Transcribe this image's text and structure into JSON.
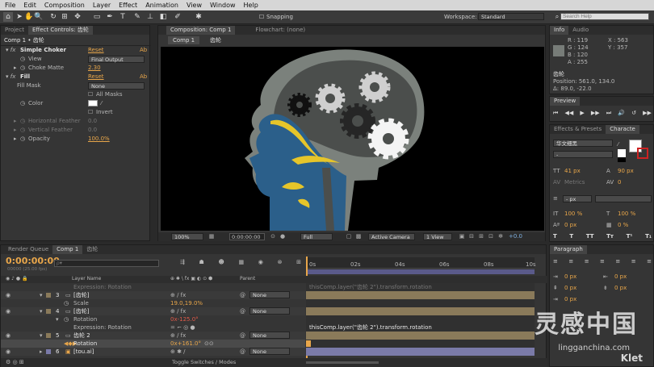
{
  "menu": [
    "File",
    "Edit",
    "Composition",
    "Layer",
    "Effect",
    "Animation",
    "View",
    "Window",
    "Help"
  ],
  "toolbar": {
    "snapping": "Snapping",
    "workspace_label": "Workspace:",
    "workspace_value": "Standard",
    "search_placeholder": "Search Help"
  },
  "effect_controls": {
    "tabs": [
      "Project",
      "Effect Controls: 齿轮"
    ],
    "breadcrumb": "Comp 1 • 齿轮",
    "effects": [
      {
        "name": "Simple Choker",
        "reset": "Reset",
        "ab": "Ab",
        "props": [
          {
            "label": "View",
            "value": "Final Output"
          },
          {
            "label": "Choke Matte",
            "value": "2.30"
          }
        ]
      },
      {
        "name": "Fill",
        "reset": "Reset",
        "ab": "Ab",
        "props": [
          {
            "label": "Fill Mask",
            "value": "None"
          },
          {
            "label": "",
            "value": "All Masks"
          },
          {
            "label": "Color",
            "value": ""
          },
          {
            "label": "",
            "value": "Invert"
          },
          {
            "label": "Horizontal Feather",
            "value": "0.0"
          },
          {
            "label": "Vertical Feather",
            "value": "0.0"
          },
          {
            "label": "Opacity",
            "value": "100.0%"
          }
        ]
      }
    ]
  },
  "composition": {
    "tabs": [
      "Composition: Comp 1",
      "Flowchart: (none)"
    ],
    "subtabs": [
      "Comp 1",
      "齿轮"
    ],
    "footer": {
      "zoom": "100%",
      "timecode": "0:00:00:00",
      "resolution": "Full",
      "camera": "Active Camera",
      "view": "1 View",
      "exposure": "+0.0"
    }
  },
  "info": {
    "tabs": [
      "Info",
      "Audio"
    ],
    "R": "R : 119",
    "G": "G : 124",
    "B": "B : 120",
    "A": "A : 255",
    "X": "X : 563",
    "Y": "Y : 357",
    "layer": "齿轮",
    "position": "Position: 561.0, 134.0",
    "delta": "Δ: 89.0, -22.0"
  },
  "preview": {
    "tab": "Preview"
  },
  "character": {
    "tabs": [
      "Effects & Presets",
      "Characte"
    ],
    "font": "华文细黑",
    "size": "41 px",
    "leading": "90 px",
    "kerning": "Metrics",
    "tracking": "0",
    "indent": "- px",
    "scale_v": "100 %",
    "scale_h": "100 %",
    "baseline": "0 px",
    "tsume": "0 %"
  },
  "paragraph": {
    "tab": "Paragraph",
    "values": [
      "0 px",
      "0 px",
      "0 px",
      "0 px",
      "0 px"
    ]
  },
  "timeline": {
    "tabs": [
      "Render Queue",
      "Comp 1",
      "齿轮"
    ],
    "timecode": "0:00:00:00",
    "fps": "00000 (25.00 fps)",
    "search_placeholder": "ρ▾",
    "headers": {
      "layer_name": "Layer Name",
      "parent": "Parent"
    },
    "rulers": [
      "0s",
      "02s",
      "04s",
      "06s",
      "08s",
      "10s"
    ],
    "toggle": "Toggle Switches / Modes",
    "rows": [
      {
        "num": "",
        "name": "Expression: Rotation",
        "value": "",
        "parent": "",
        "expr": "thisComp.layer(\"齿轮 2\").transform.rotation"
      },
      {
        "num": "3",
        "name": "[齿轮]",
        "value": "",
        "parent": "None",
        "expr": ""
      },
      {
        "num": "",
        "name": "Scale",
        "value": "19.0,19.0%",
        "parent": "",
        "expr": ""
      },
      {
        "num": "4",
        "name": "[齿轮]",
        "value": "",
        "parent": "None",
        "expr": ""
      },
      {
        "num": "",
        "name": "Rotation",
        "value": "0x-125.0°",
        "parent": "",
        "expr": ""
      },
      {
        "num": "",
        "name": "Expression: Rotation",
        "value": "",
        "parent": "",
        "expr": "thisComp.layer(\"齿轮 2\").transform.rotation"
      },
      {
        "num": "5",
        "name": "齿轮 2",
        "value": "",
        "parent": "None",
        "expr": ""
      },
      {
        "num": "",
        "name": "Rotation",
        "value": "0x+161.0°",
        "parent": "",
        "expr": ""
      },
      {
        "num": "6",
        "name": "[tou.ai]",
        "value": "",
        "parent": "None",
        "expr": ""
      }
    ]
  },
  "watermark": {
    "main": "灵感中国",
    "sub": "lingganchina.com",
    "logo": "Klet"
  },
  "colors": {
    "accent": "#e8a64a",
    "track": "#8a7a5a",
    "head_gray": "#7b817c",
    "face_blue": "#2b5f8a",
    "yellow": "#e6c52a",
    "gear_white": "#e8e8e8",
    "gear_dark": "#2a2a2a"
  }
}
